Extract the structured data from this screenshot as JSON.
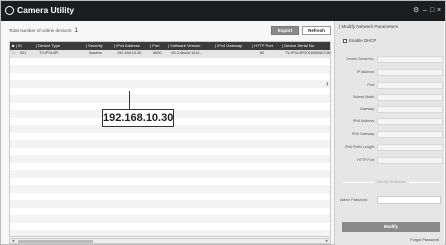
{
  "window": {
    "title": "Camera Utility",
    "controls": [
      "⚙",
      "–",
      "□",
      "×"
    ]
  },
  "toolbar": {
    "online_label": "Total number of online devices:",
    "online_count": "1",
    "export_label": "Export",
    "refresh_label": "Refresh"
  },
  "table": {
    "headers": [
      "ID",
      "Device Type",
      "Security",
      "IPv4 Address",
      "Port",
      "Software Version",
      "IPv4 Gateway",
      "HTTP Port",
      "Device Serial No."
    ],
    "rows": [
      [
        "001",
        "TV-IP314PI",
        "Inactive",
        "192.168.10.30",
        "8000",
        "V5.3.4build 1612...",
        "",
        "80",
        "TV-IP314PI20160506CCW"
      ]
    ]
  },
  "callout": {
    "text": "192.168.10.30"
  },
  "panel": {
    "title": "Modify Network Parameters",
    "dhcp_label": "Enable DHCP",
    "fields": [
      "Device Serial No.:",
      "IP Address:",
      "Port:",
      "Subnet Mask:",
      "Gateway:",
      "IPv6 Address:",
      "IPv6 Gateway:",
      "IPv6 Prefix Length:",
      "HTTP Port:"
    ],
    "security_label": "Security Verification",
    "admin_label": "Admin Password:",
    "modify_label": "Modify",
    "forgot_label": "Forgot Password"
  }
}
